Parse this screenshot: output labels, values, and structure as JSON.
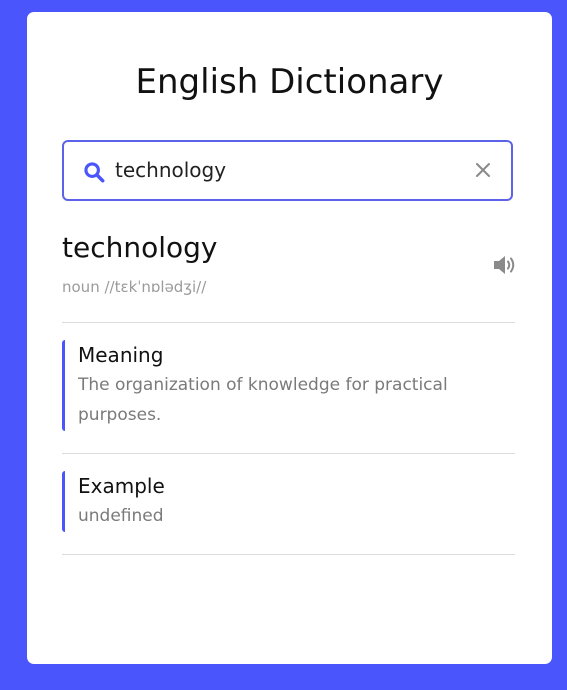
{
  "app": {
    "title": "English Dictionary"
  },
  "search": {
    "query": "technology",
    "search_icon": "search-icon",
    "clear_icon": "close-icon"
  },
  "entry": {
    "word": "technology",
    "phonetic": "noun //tɛkˈnɒlədʒi//",
    "audio_icon": "speaker-icon"
  },
  "sections": {
    "meaning": {
      "heading": "Meaning",
      "text": "The organization of knowledge for practical purposes."
    },
    "example": {
      "heading": "Example",
      "text": "undefined"
    }
  },
  "colors": {
    "background": "#4a56fb",
    "accent": "#5d63e8",
    "card": "#ffffff"
  }
}
